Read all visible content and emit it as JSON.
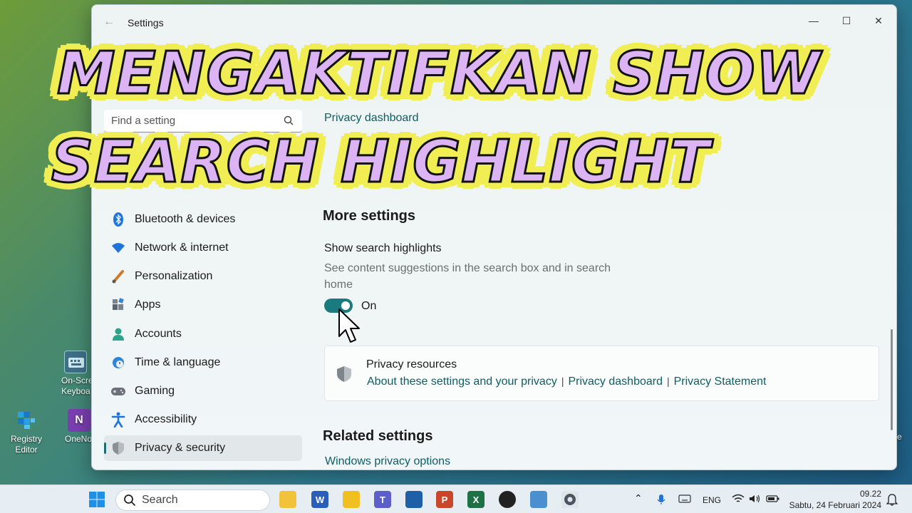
{
  "overlay": {
    "line1": "MENGAKTIFKAN SHOW",
    "line2": "SEARCH HIGHLIGHT"
  },
  "desktop": {
    "icons": [
      {
        "label": "On-Scre\nKeyboa",
        "icon": "keyboard-icon"
      },
      {
        "label": "Registry\nEditor",
        "icon": "registry-icon"
      },
      {
        "label": "OneNo",
        "icon": "onenote-icon"
      }
    ],
    "edge_label": "e"
  },
  "window": {
    "title": "Settings",
    "controls": {
      "minimize": "—",
      "maximize": "☐",
      "close": "✕"
    }
  },
  "sidebar": {
    "search_placeholder": "Find a setting",
    "items": [
      {
        "label": "Bluetooth & devices",
        "icon": "bluetooth-icon"
      },
      {
        "label": "Network & internet",
        "icon": "wifi-icon"
      },
      {
        "label": "Personalization",
        "icon": "brush-icon"
      },
      {
        "label": "Apps",
        "icon": "apps-icon"
      },
      {
        "label": "Accounts",
        "icon": "person-icon"
      },
      {
        "label": "Time & language",
        "icon": "clock-globe-icon"
      },
      {
        "label": "Gaming",
        "icon": "gamepad-icon"
      },
      {
        "label": "Accessibility",
        "icon": "accessibility-icon"
      },
      {
        "label": "Privacy & security",
        "icon": "shield-icon",
        "active": true
      }
    ]
  },
  "main": {
    "top_link": "Privacy dashboard",
    "more_settings": {
      "heading": "More settings",
      "title": "Show search highlights",
      "description": "See content suggestions in the search box and in search home",
      "toggle_state": "On"
    },
    "privacy_resources": {
      "title": "Privacy resources",
      "links": [
        "About these settings and your privacy",
        "Privacy dashboard",
        "Privacy Statement"
      ],
      "separator": "|"
    },
    "related": {
      "heading": "Related settings",
      "link": "Windows privacy options"
    }
  },
  "taskbar": {
    "search_label": "Search",
    "language": "ENG",
    "time": "09.22",
    "date": "Sabtu, 24 Februari 2024"
  },
  "colors": {
    "accent": "#1b7a7e",
    "link": "#0d5e63",
    "caption_fill": "#dcb4f4",
    "caption_outline": "#f0ee52"
  }
}
